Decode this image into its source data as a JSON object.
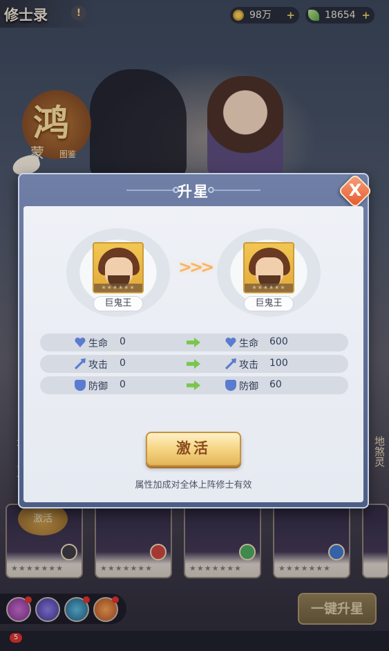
{
  "header": {
    "title": "修士录",
    "info_icon": "!",
    "resources": [
      {
        "icon": "coin-icon",
        "value": "98万"
      },
      {
        "icon": "jade-leaf-icon",
        "value": "18654"
      }
    ]
  },
  "background": {
    "seal_char": "鸿",
    "seal_sub": "蒙",
    "seal_sub2": "图鉴",
    "card_activate_label": "激活",
    "side_left": "无巨鬼王",
    "side_right": "地煞灵",
    "one_key_button": "一键升星",
    "notification_badge": "5"
  },
  "modal": {
    "title": "升星",
    "close_label": "X",
    "before": {
      "name": "巨鬼王"
    },
    "after": {
      "name": "巨鬼王"
    },
    "arrow": ">>>",
    "stats": [
      {
        "icon": "heart-icon",
        "label": "生命",
        "before": "0",
        "after": "600"
      },
      {
        "icon": "sword-icon",
        "label": "攻击",
        "before": "0",
        "after": "100"
      },
      {
        "icon": "shield-icon",
        "label": "防御",
        "before": "0",
        "after": "60"
      }
    ],
    "activate_label": "激活",
    "hint": "属性加成对全体上阵修士有效"
  },
  "colors": {
    "accent_gold": "#e4b65a",
    "close_orange": "#e65a2c",
    "stat_blue": "#5b7bd0",
    "arrow_green": "#7ac64b"
  }
}
